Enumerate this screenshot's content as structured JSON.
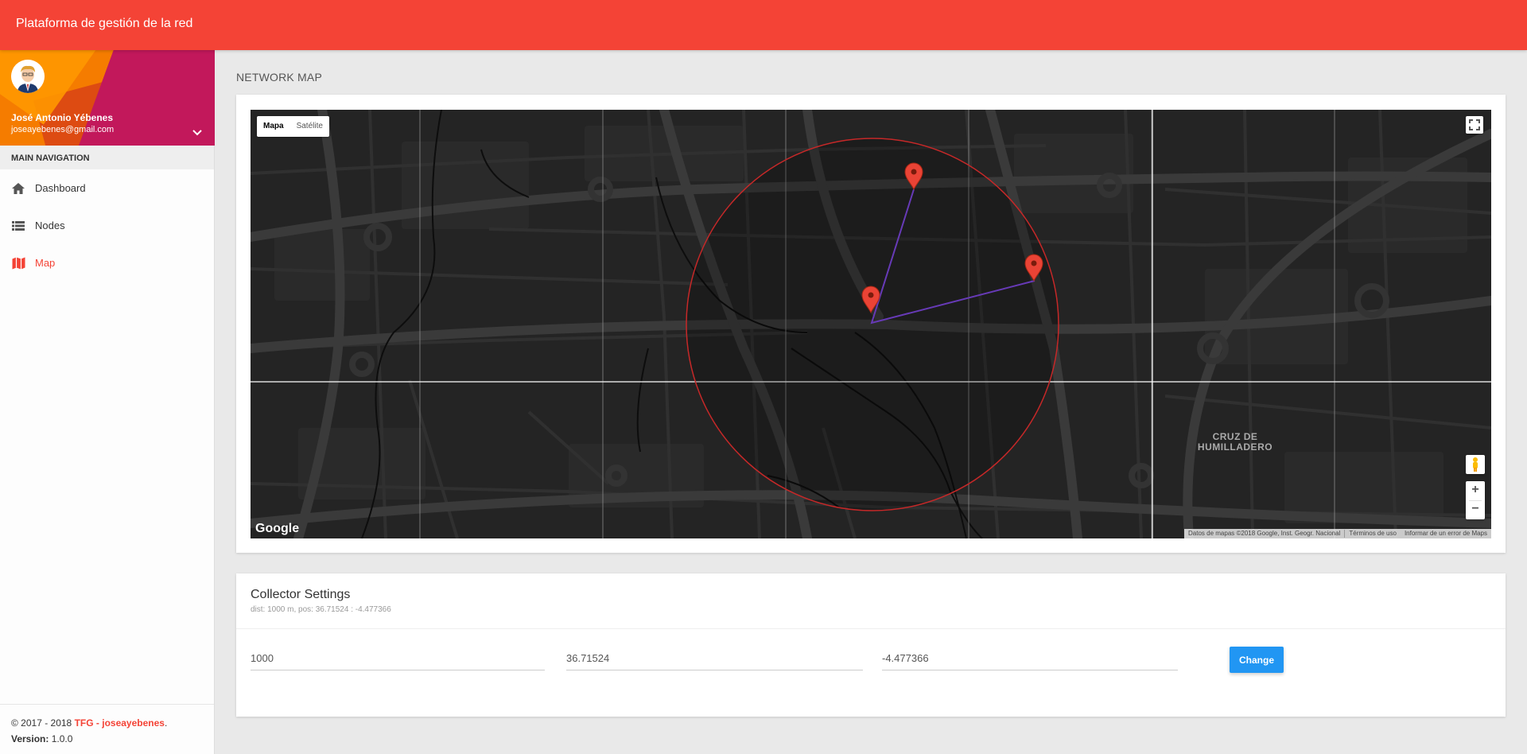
{
  "app": {
    "title": "Plataforma de gestión de la red"
  },
  "user": {
    "name": "José Antonio Yébenes",
    "email": "joseayebenes@gmail.com"
  },
  "nav": {
    "header": "MAIN NAVIGATION",
    "items": [
      {
        "label": "Dashboard",
        "icon": "home-icon",
        "active": false
      },
      {
        "label": "Nodes",
        "icon": "list-icon",
        "active": false
      },
      {
        "label": "Map",
        "icon": "map-icon",
        "active": true
      }
    ]
  },
  "footer": {
    "copyright": "© 2017 - 2018",
    "brand": "TFG - joseayebenes",
    "brand_suffix": ".",
    "version_label": "Version:",
    "version": "1.0.0"
  },
  "page": {
    "title": "NETWORK MAP"
  },
  "map": {
    "type_buttons": [
      "Mapa",
      "Satélite"
    ],
    "selected_type": "Mapa",
    "area_label": [
      "CRUZ DE",
      "HUMILLADERO"
    ],
    "zoom_in": "+",
    "zoom_out": "−",
    "logo": "Google",
    "attribution": {
      "data": "Datos de mapas ©2018 Google, Inst. Geogr. Nacional",
      "terms": "Términos de uso",
      "report": "Informar de un error de Maps"
    },
    "colors": {
      "background": "#242424",
      "circle": "#c62828",
      "line": "#673ab7",
      "marker": "#ea4335"
    }
  },
  "settings": {
    "title": "Collector Settings",
    "subtitle": "dist: 1000 m, pos: 36.71524 : -4.477366",
    "distance": "1000",
    "latitude": "36.71524",
    "longitude": "-4.477366",
    "button": "Change"
  },
  "colors": {
    "primary": "#f44336",
    "button": "#2196f3"
  }
}
